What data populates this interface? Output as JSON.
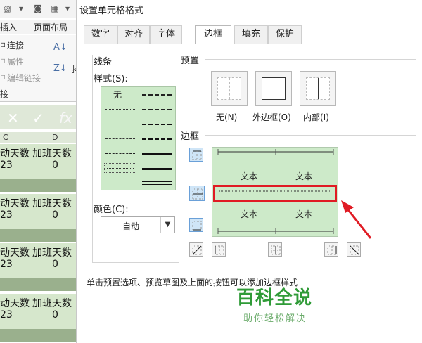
{
  "excel": {
    "menu": {
      "insert": "插入",
      "page_layout": "页面布局"
    },
    "ribbon": {
      "connect": "连接",
      "properties": "属性",
      "edit_links": "编辑链接",
      "section": "接",
      "extra": "排"
    },
    "formula_bar": {
      "cancel": "✕",
      "confirm": "✓",
      "fx": "fx"
    },
    "columns": [
      "C",
      "D"
    ],
    "rows": [
      {
        "col_c": "动天数",
        "col_d": "加班天数",
        "val_c": "23",
        "val_d": "0"
      },
      {
        "col_c": "动天数",
        "col_d": "加班天数",
        "val_c": "23",
        "val_d": "0"
      },
      {
        "col_c": "动天数",
        "col_d": "加班天数",
        "val_c": "23",
        "val_d": "0"
      },
      {
        "col_c": "动天数",
        "col_d": "加班天数",
        "val_c": "23",
        "val_d": "0"
      }
    ]
  },
  "dialog": {
    "title": "设置单元格格式",
    "tabs": [
      "数字",
      "对齐",
      "字体",
      "边框",
      "填充",
      "保护"
    ],
    "active_tab": "边框",
    "line_group": {
      "title": "线条",
      "style_label": "样式(S):",
      "none_label": "无",
      "color_label": "颜色(C):",
      "color_value": "自动"
    },
    "presets": {
      "title": "预置",
      "none": "无(N)",
      "outline": "外边框(O)",
      "inside": "内部(I)"
    },
    "border": {
      "title": "边框",
      "preview_text": [
        "文本",
        "文本",
        "文本",
        "文本"
      ]
    },
    "hint": "单击预置选项、预览草图及上面的按钮可以添加边框样式"
  },
  "watermark": {
    "line1": "百科全说",
    "line2": "助你轻松解决"
  },
  "colors": {
    "highlight": "#e01b24",
    "preview_bg": "#cdeac9",
    "watermark": "#2f9b37"
  }
}
